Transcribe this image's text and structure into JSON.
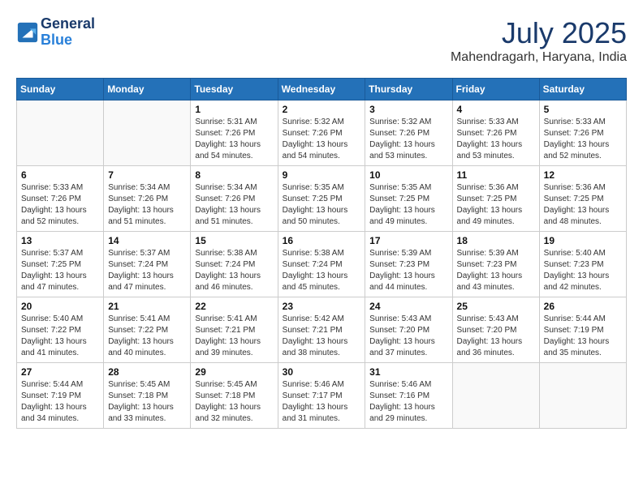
{
  "header": {
    "logo_line1": "General",
    "logo_line2": "Blue",
    "month": "July 2025",
    "location": "Mahendragarh, Haryana, India"
  },
  "weekdays": [
    "Sunday",
    "Monday",
    "Tuesday",
    "Wednesday",
    "Thursday",
    "Friday",
    "Saturday"
  ],
  "weeks": [
    [
      {
        "day": "",
        "info": ""
      },
      {
        "day": "",
        "info": ""
      },
      {
        "day": "1",
        "info": "Sunrise: 5:31 AM\nSunset: 7:26 PM\nDaylight: 13 hours and 54 minutes."
      },
      {
        "day": "2",
        "info": "Sunrise: 5:32 AM\nSunset: 7:26 PM\nDaylight: 13 hours and 54 minutes."
      },
      {
        "day": "3",
        "info": "Sunrise: 5:32 AM\nSunset: 7:26 PM\nDaylight: 13 hours and 53 minutes."
      },
      {
        "day": "4",
        "info": "Sunrise: 5:33 AM\nSunset: 7:26 PM\nDaylight: 13 hours and 53 minutes."
      },
      {
        "day": "5",
        "info": "Sunrise: 5:33 AM\nSunset: 7:26 PM\nDaylight: 13 hours and 52 minutes."
      }
    ],
    [
      {
        "day": "6",
        "info": "Sunrise: 5:33 AM\nSunset: 7:26 PM\nDaylight: 13 hours and 52 minutes."
      },
      {
        "day": "7",
        "info": "Sunrise: 5:34 AM\nSunset: 7:26 PM\nDaylight: 13 hours and 51 minutes."
      },
      {
        "day": "8",
        "info": "Sunrise: 5:34 AM\nSunset: 7:26 PM\nDaylight: 13 hours and 51 minutes."
      },
      {
        "day": "9",
        "info": "Sunrise: 5:35 AM\nSunset: 7:25 PM\nDaylight: 13 hours and 50 minutes."
      },
      {
        "day": "10",
        "info": "Sunrise: 5:35 AM\nSunset: 7:25 PM\nDaylight: 13 hours and 49 minutes."
      },
      {
        "day": "11",
        "info": "Sunrise: 5:36 AM\nSunset: 7:25 PM\nDaylight: 13 hours and 49 minutes."
      },
      {
        "day": "12",
        "info": "Sunrise: 5:36 AM\nSunset: 7:25 PM\nDaylight: 13 hours and 48 minutes."
      }
    ],
    [
      {
        "day": "13",
        "info": "Sunrise: 5:37 AM\nSunset: 7:25 PM\nDaylight: 13 hours and 47 minutes."
      },
      {
        "day": "14",
        "info": "Sunrise: 5:37 AM\nSunset: 7:24 PM\nDaylight: 13 hours and 47 minutes."
      },
      {
        "day": "15",
        "info": "Sunrise: 5:38 AM\nSunset: 7:24 PM\nDaylight: 13 hours and 46 minutes."
      },
      {
        "day": "16",
        "info": "Sunrise: 5:38 AM\nSunset: 7:24 PM\nDaylight: 13 hours and 45 minutes."
      },
      {
        "day": "17",
        "info": "Sunrise: 5:39 AM\nSunset: 7:23 PM\nDaylight: 13 hours and 44 minutes."
      },
      {
        "day": "18",
        "info": "Sunrise: 5:39 AM\nSunset: 7:23 PM\nDaylight: 13 hours and 43 minutes."
      },
      {
        "day": "19",
        "info": "Sunrise: 5:40 AM\nSunset: 7:23 PM\nDaylight: 13 hours and 42 minutes."
      }
    ],
    [
      {
        "day": "20",
        "info": "Sunrise: 5:40 AM\nSunset: 7:22 PM\nDaylight: 13 hours and 41 minutes."
      },
      {
        "day": "21",
        "info": "Sunrise: 5:41 AM\nSunset: 7:22 PM\nDaylight: 13 hours and 40 minutes."
      },
      {
        "day": "22",
        "info": "Sunrise: 5:41 AM\nSunset: 7:21 PM\nDaylight: 13 hours and 39 minutes."
      },
      {
        "day": "23",
        "info": "Sunrise: 5:42 AM\nSunset: 7:21 PM\nDaylight: 13 hours and 38 minutes."
      },
      {
        "day": "24",
        "info": "Sunrise: 5:43 AM\nSunset: 7:20 PM\nDaylight: 13 hours and 37 minutes."
      },
      {
        "day": "25",
        "info": "Sunrise: 5:43 AM\nSunset: 7:20 PM\nDaylight: 13 hours and 36 minutes."
      },
      {
        "day": "26",
        "info": "Sunrise: 5:44 AM\nSunset: 7:19 PM\nDaylight: 13 hours and 35 minutes."
      }
    ],
    [
      {
        "day": "27",
        "info": "Sunrise: 5:44 AM\nSunset: 7:19 PM\nDaylight: 13 hours and 34 minutes."
      },
      {
        "day": "28",
        "info": "Sunrise: 5:45 AM\nSunset: 7:18 PM\nDaylight: 13 hours and 33 minutes."
      },
      {
        "day": "29",
        "info": "Sunrise: 5:45 AM\nSunset: 7:18 PM\nDaylight: 13 hours and 32 minutes."
      },
      {
        "day": "30",
        "info": "Sunrise: 5:46 AM\nSunset: 7:17 PM\nDaylight: 13 hours and 31 minutes."
      },
      {
        "day": "31",
        "info": "Sunrise: 5:46 AM\nSunset: 7:16 PM\nDaylight: 13 hours and 29 minutes."
      },
      {
        "day": "",
        "info": ""
      },
      {
        "day": "",
        "info": ""
      }
    ]
  ]
}
